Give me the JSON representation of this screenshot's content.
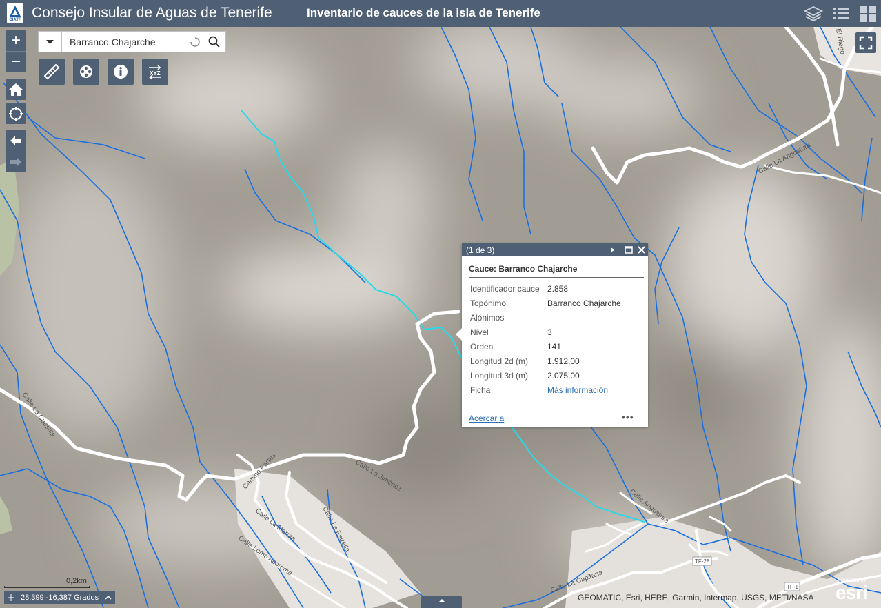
{
  "header": {
    "logo_label": "CIATF",
    "app_title": "Consejo Insular de Aguas de Tenerife",
    "map_title": "Inventario de cauces de la isla de Tenerife"
  },
  "search": {
    "value": "Barranco Chajarche"
  },
  "popup": {
    "counter": "(1 de 3)",
    "title": "Cauce: Barranco Chajarche",
    "fields": [
      {
        "key": "Identificador cauce",
        "value": "2.858"
      },
      {
        "key": "Topónimo",
        "value": "Barranco Chajarche"
      },
      {
        "key": "Alónimos",
        "value": ""
      },
      {
        "key": "Nivel",
        "value": "3"
      },
      {
        "key": "Orden",
        "value": "141"
      },
      {
        "key": "Longitud 2d (m)",
        "value": "1.912,00"
      },
      {
        "key": "Longitud 3d (m)",
        "value": "2.075,00"
      },
      {
        "key": "Ficha",
        "value": "Más información"
      }
    ],
    "zoom_link": "Acercar a",
    "more": "•••"
  },
  "map": {
    "road_labels": {
      "angostura_a": "Calle La Angostura",
      "cuestita": "Calle La Cuestita",
      "jimenez": "Calle La Jiménez",
      "camino_partes": "Camino Partes",
      "morrita": "Calle La Morrita",
      "estrella": "Calle La Estrella",
      "lomo_acorona": "Calle Lomo Acoroma",
      "capitana": "Calle La Capitana",
      "angostura_b": "Calle Angostura",
      "el_riego": "El Riego",
      "tf28": "TF-28",
      "tf1": "TF-1"
    },
    "colors": {
      "stream": "#1a6fe0",
      "selected_stream": "#29d9e8",
      "road": "#ffffff",
      "header": "#4f5f74"
    }
  },
  "footer": {
    "scale_label": "0,2km",
    "coords": "28,399 -16,387 Grados",
    "attribution": "GEOMATIC, Esri, HERE, Garmin, Intermap, USGS, METI/NASA",
    "esri_powered": "POWERED BY",
    "esri_name": "esri"
  }
}
